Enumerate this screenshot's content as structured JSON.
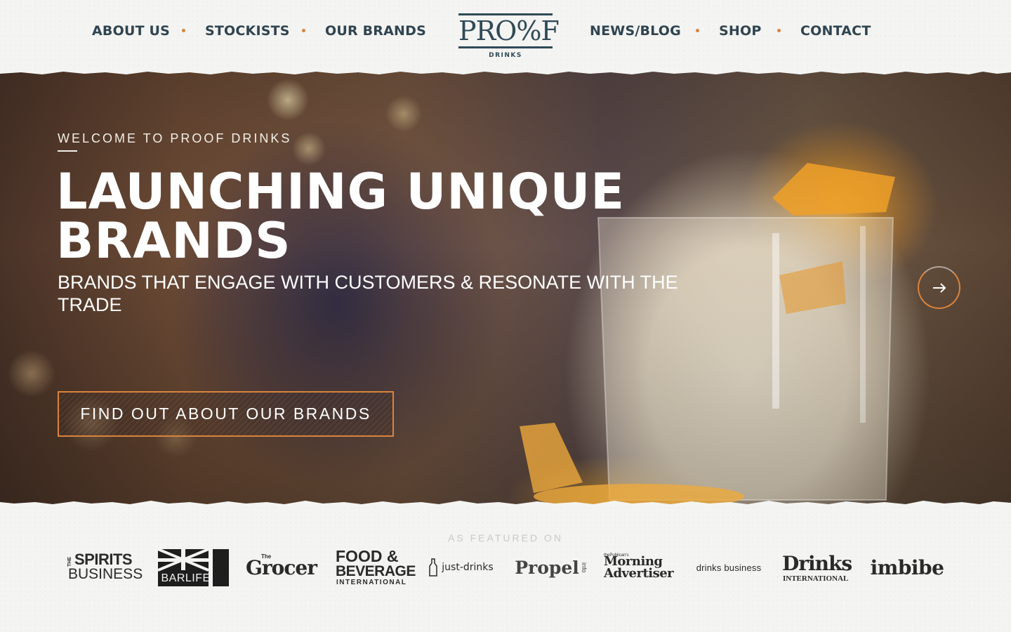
{
  "nav": {
    "left": [
      {
        "label": "ABOUT US"
      },
      {
        "label": "STOCKISTS"
      },
      {
        "label": "OUR BRANDS"
      }
    ],
    "right": [
      {
        "label": "NEWS/BLOG"
      },
      {
        "label": "SHOP"
      },
      {
        "label": "CONTACT"
      }
    ]
  },
  "logo": {
    "word": "PRO%F",
    "sub": "DRINKS"
  },
  "hero": {
    "eyebrow": "WELCOME TO PROOF DRINKS",
    "title": "LAUNCHING UNIQUE BRANDS",
    "subtitle": "BRANDS THAT ENGAGE WITH CUSTOMERS & RESONATE WITH THE TRADE",
    "cta": "FIND OUT ABOUT OUR BRANDS",
    "next_icon": "arrow-right-icon"
  },
  "featured": {
    "label": "AS FEATURED ON",
    "brands": {
      "spirits_business": {
        "line1": "THE",
        "line2": "SPIRITS",
        "line3": "BUSINESS"
      },
      "barlife": "BARLIFE",
      "grocer": {
        "small": "The",
        "main": "Grocer"
      },
      "food_beverage": {
        "line1": "FOOD &",
        "line2": "BEVERAGE",
        "line3": "INTERNATIONAL"
      },
      "just_drinks": "just-drinks",
      "propel": {
        "main": "Propel",
        "small": "info"
      },
      "morning_advertiser": {
        "small": "thePublican's",
        "line1": "Morning",
        "line2": "Advertiser"
      },
      "drinks_business": "drinks business",
      "drinks_international": {
        "main": "Drinks",
        "sub": "INTERNATIONAL"
      },
      "imbibe": "imbibe"
    }
  },
  "colors": {
    "accent": "#d9843d",
    "nav_text": "#2f4450",
    "background": "#f4f4f2"
  }
}
